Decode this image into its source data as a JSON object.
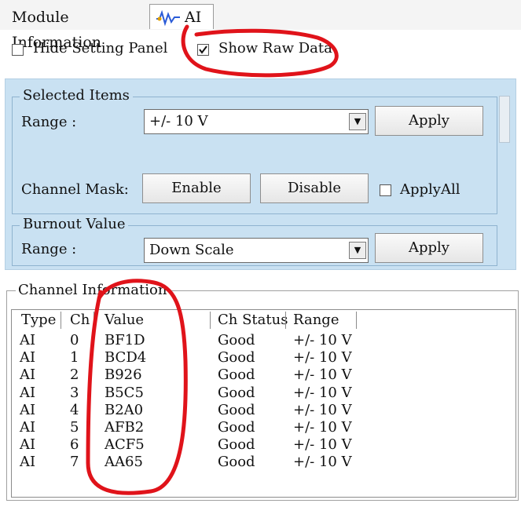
{
  "tabs": [
    {
      "label": "Module Information"
    },
    {
      "label": "AI"
    }
  ],
  "options": {
    "hide_setting_panel": {
      "label": "Hide Setting Panel",
      "checked": false
    },
    "show_raw_data": {
      "label": "Show Raw Data",
      "checked": true
    }
  },
  "selected_items": {
    "title": "Selected Items",
    "range_label": "Range :",
    "range_value": "+/- 10 V",
    "apply_label": "Apply",
    "channel_mask_label": "Channel Mask:",
    "enable_label": "Enable",
    "disable_label": "Disable",
    "apply_all_label": "ApplyAll"
  },
  "burnout": {
    "title": "Burnout Value",
    "range_label": "Range :",
    "range_value": "Down Scale",
    "apply_label": "Apply"
  },
  "channel_info": {
    "title": "Channel Information",
    "columns": [
      "Type",
      "Ch",
      "Value",
      "Ch Status",
      "Range"
    ],
    "rows": [
      {
        "type": "AI",
        "ch": "0",
        "value": "BF1D",
        "status": "Good",
        "range": "+/- 10 V"
      },
      {
        "type": "AI",
        "ch": "1",
        "value": "BCD4",
        "status": "Good",
        "range": "+/- 10 V"
      },
      {
        "type": "AI",
        "ch": "2",
        "value": "B926",
        "status": "Good",
        "range": "+/- 10 V"
      },
      {
        "type": "AI",
        "ch": "3",
        "value": "B5C5",
        "status": "Good",
        "range": "+/- 10 V"
      },
      {
        "type": "AI",
        "ch": "4",
        "value": "B2A0",
        "status": "Good",
        "range": "+/- 10 V"
      },
      {
        "type": "AI",
        "ch": "5",
        "value": "AFB2",
        "status": "Good",
        "range": "+/- 10 V"
      },
      {
        "type": "AI",
        "ch": "6",
        "value": "ACF5",
        "status": "Good",
        "range": "+/- 10 V"
      },
      {
        "type": "AI",
        "ch": "7",
        "value": "AA65",
        "status": "Good",
        "range": "+/- 10 V"
      }
    ]
  },
  "colors": {
    "panel_bg": "#c9e1f2",
    "annotation_red": "#e0131a"
  }
}
